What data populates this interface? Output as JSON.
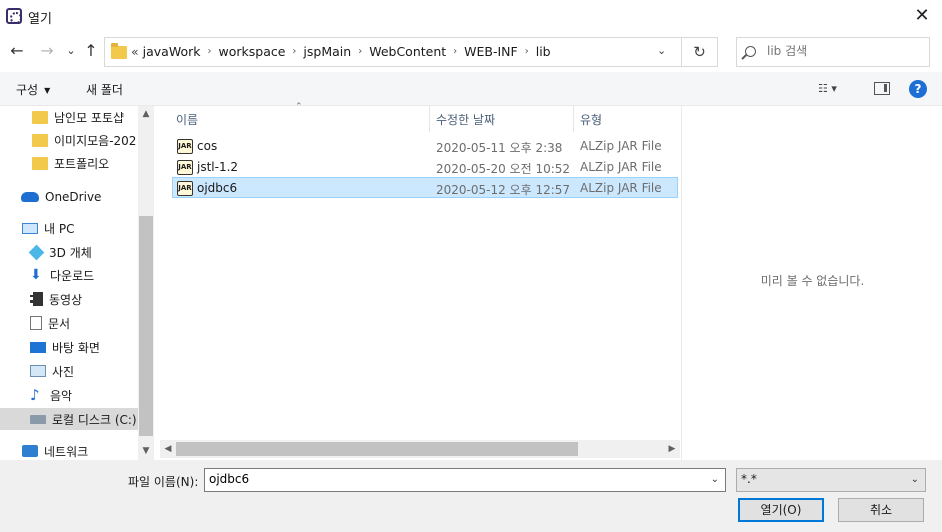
{
  "window": {
    "title": "열기",
    "close_glyph": "✕"
  },
  "nav": {
    "back": "←",
    "forward": "→",
    "recent": "⌄",
    "up": "↑"
  },
  "address": {
    "lead": "«",
    "crumbs": [
      "javaWork",
      "workspace",
      "jspMain",
      "WebContent",
      "WEB-INF",
      "lib"
    ],
    "separator": "›",
    "dropdown": "⌄",
    "refresh": "↻"
  },
  "search": {
    "placeholder": "lib 검색"
  },
  "commands": {
    "organize": "구성",
    "new_folder": "새 폴더",
    "view": "☷ ▾",
    "help": "?"
  },
  "sidebar": {
    "items": [
      {
        "label": "남인모 포토샵",
        "icon": "folder-icon"
      },
      {
        "label": "이미지모음-202",
        "icon": "folder-icon"
      },
      {
        "label": "포트폴리오",
        "icon": "folder-icon"
      },
      {
        "label": "OneDrive",
        "icon": "onedrive-icon"
      },
      {
        "label": "내 PC",
        "icon": "pc-icon"
      },
      {
        "label": "3D 개체",
        "icon": "cube-icon"
      },
      {
        "label": "다운로드",
        "icon": "download-icon"
      },
      {
        "label": "동영상",
        "icon": "video-icon"
      },
      {
        "label": "문서",
        "icon": "document-icon"
      },
      {
        "label": "바탕 화면",
        "icon": "desktop-icon"
      },
      {
        "label": "사진",
        "icon": "picture-icon"
      },
      {
        "label": "음악",
        "icon": "music-icon"
      },
      {
        "label": "로컬 디스크 (C:)",
        "icon": "drive-icon"
      },
      {
        "label": "네트워크",
        "icon": "network-icon"
      }
    ],
    "selected": "로컬 디스크 (C:)"
  },
  "columns": {
    "name": "이름",
    "date": "수정한 날짜",
    "type": "유형"
  },
  "files": [
    {
      "name": "cos",
      "date": "2020-05-11 오후 2:38",
      "type": "ALZip JAR File",
      "icon": "jar-icon"
    },
    {
      "name": "jstl-1.2",
      "date": "2020-05-20 오전 10:52",
      "type": "ALZip JAR File",
      "icon": "jar-icon"
    },
    {
      "name": "ojdbc6",
      "date": "2020-05-12 오후 12:57",
      "type": "ALZip JAR File",
      "icon": "jar-icon"
    }
  ],
  "selected_file": "ojdbc6",
  "jar_glyph": "JAR",
  "preview": {
    "message": "미리 볼 수 없습니다."
  },
  "footer": {
    "filename_label": "파일 이름(N):",
    "filename_value": "ojdbc6",
    "filetype_value": "*.*",
    "open_label": "열기(O)",
    "cancel_label": "취소"
  },
  "colors": {
    "accent": "#0078d7",
    "selection": "#cce8ff",
    "selection_border": "#99d1ff",
    "folder": "#f3c94b"
  }
}
